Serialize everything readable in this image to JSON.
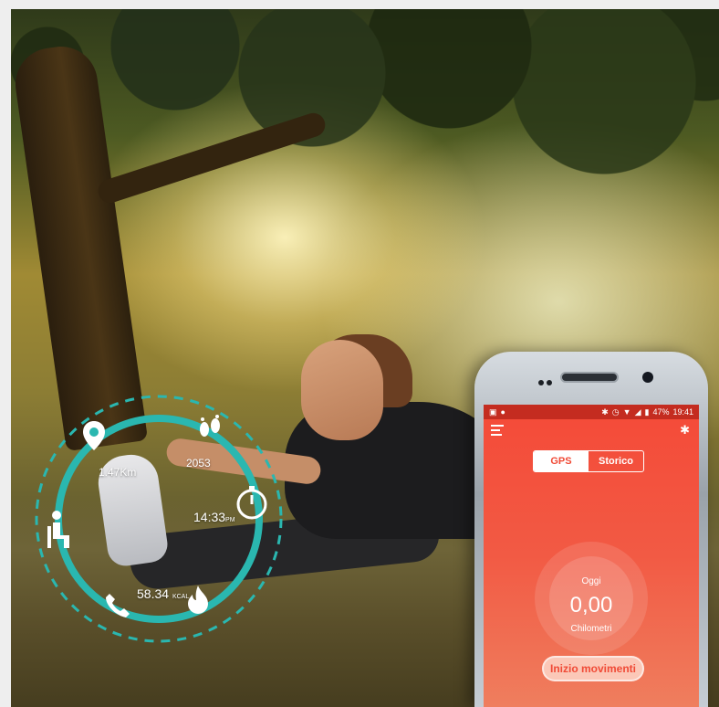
{
  "ring": {
    "distance": "1.47Km",
    "steps": "2053",
    "time": "14:33",
    "time_suffix": "PM",
    "calories": "58.34",
    "calories_unit": "KCAL",
    "accent_color": "#2ab7b0",
    "icons": [
      "location-pin-icon",
      "footprints-icon",
      "stopwatch-icon",
      "flame-icon",
      "phone-call-icon",
      "sitting-person-icon"
    ]
  },
  "phone": {
    "status": {
      "battery": "47%",
      "clock": "19:41"
    },
    "tabs": [
      {
        "label": "GPS",
        "active": true
      },
      {
        "label": "Storico",
        "active": false
      }
    ],
    "gauge": {
      "period": "Oggi",
      "value": "0,00",
      "unit": "Chilometri"
    },
    "start_button": "Inizio movimenti",
    "screen_color": "#f44a38"
  }
}
